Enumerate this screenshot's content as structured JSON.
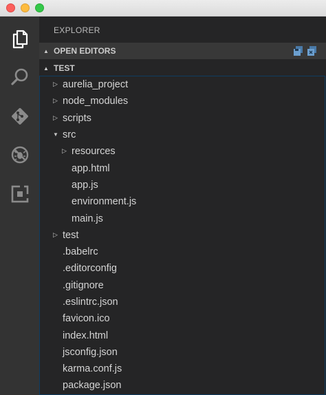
{
  "explorer": {
    "title": "EXPLORER",
    "sections": {
      "open_editors": "OPEN EDITORS",
      "workspace": "TEST"
    }
  },
  "activity_bar": {
    "icons": [
      "files-icon",
      "search-icon",
      "git-icon",
      "debug-icon",
      "extensions-icon"
    ]
  },
  "tree": [
    {
      "label": "aurelia_project",
      "type": "folder",
      "expanded": false,
      "depth": 0
    },
    {
      "label": "node_modules",
      "type": "folder",
      "expanded": false,
      "depth": 0
    },
    {
      "label": "scripts",
      "type": "folder",
      "expanded": false,
      "depth": 0
    },
    {
      "label": "src",
      "type": "folder",
      "expanded": true,
      "depth": 0
    },
    {
      "label": "resources",
      "type": "folder",
      "expanded": false,
      "depth": 1
    },
    {
      "label": "app.html",
      "type": "file",
      "depth": 1
    },
    {
      "label": "app.js",
      "type": "file",
      "depth": 1
    },
    {
      "label": "environment.js",
      "type": "file",
      "depth": 1
    },
    {
      "label": "main.js",
      "type": "file",
      "depth": 1
    },
    {
      "label": "test",
      "type": "folder",
      "expanded": false,
      "depth": 0
    },
    {
      "label": ".babelrc",
      "type": "file",
      "depth": 0
    },
    {
      "label": ".editorconfig",
      "type": "file",
      "depth": 0
    },
    {
      "label": ".gitignore",
      "type": "file",
      "depth": 0
    },
    {
      "label": ".eslintrc.json",
      "type": "file",
      "depth": 0
    },
    {
      "label": "favicon.ico",
      "type": "file",
      "depth": 0
    },
    {
      "label": "index.html",
      "type": "file",
      "depth": 0
    },
    {
      "label": "jsconfig.json",
      "type": "file",
      "depth": 0
    },
    {
      "label": "karma.conf.js",
      "type": "file",
      "depth": 0
    },
    {
      "label": "package.json",
      "type": "file",
      "depth": 0
    }
  ],
  "colors": {
    "activity_bar": "#333333",
    "sidebar": "#252526",
    "open_editors_header": "#383838",
    "focus_border": "#0e3d62",
    "text": "#d4d4d4",
    "icon": "#c5c5c5"
  }
}
